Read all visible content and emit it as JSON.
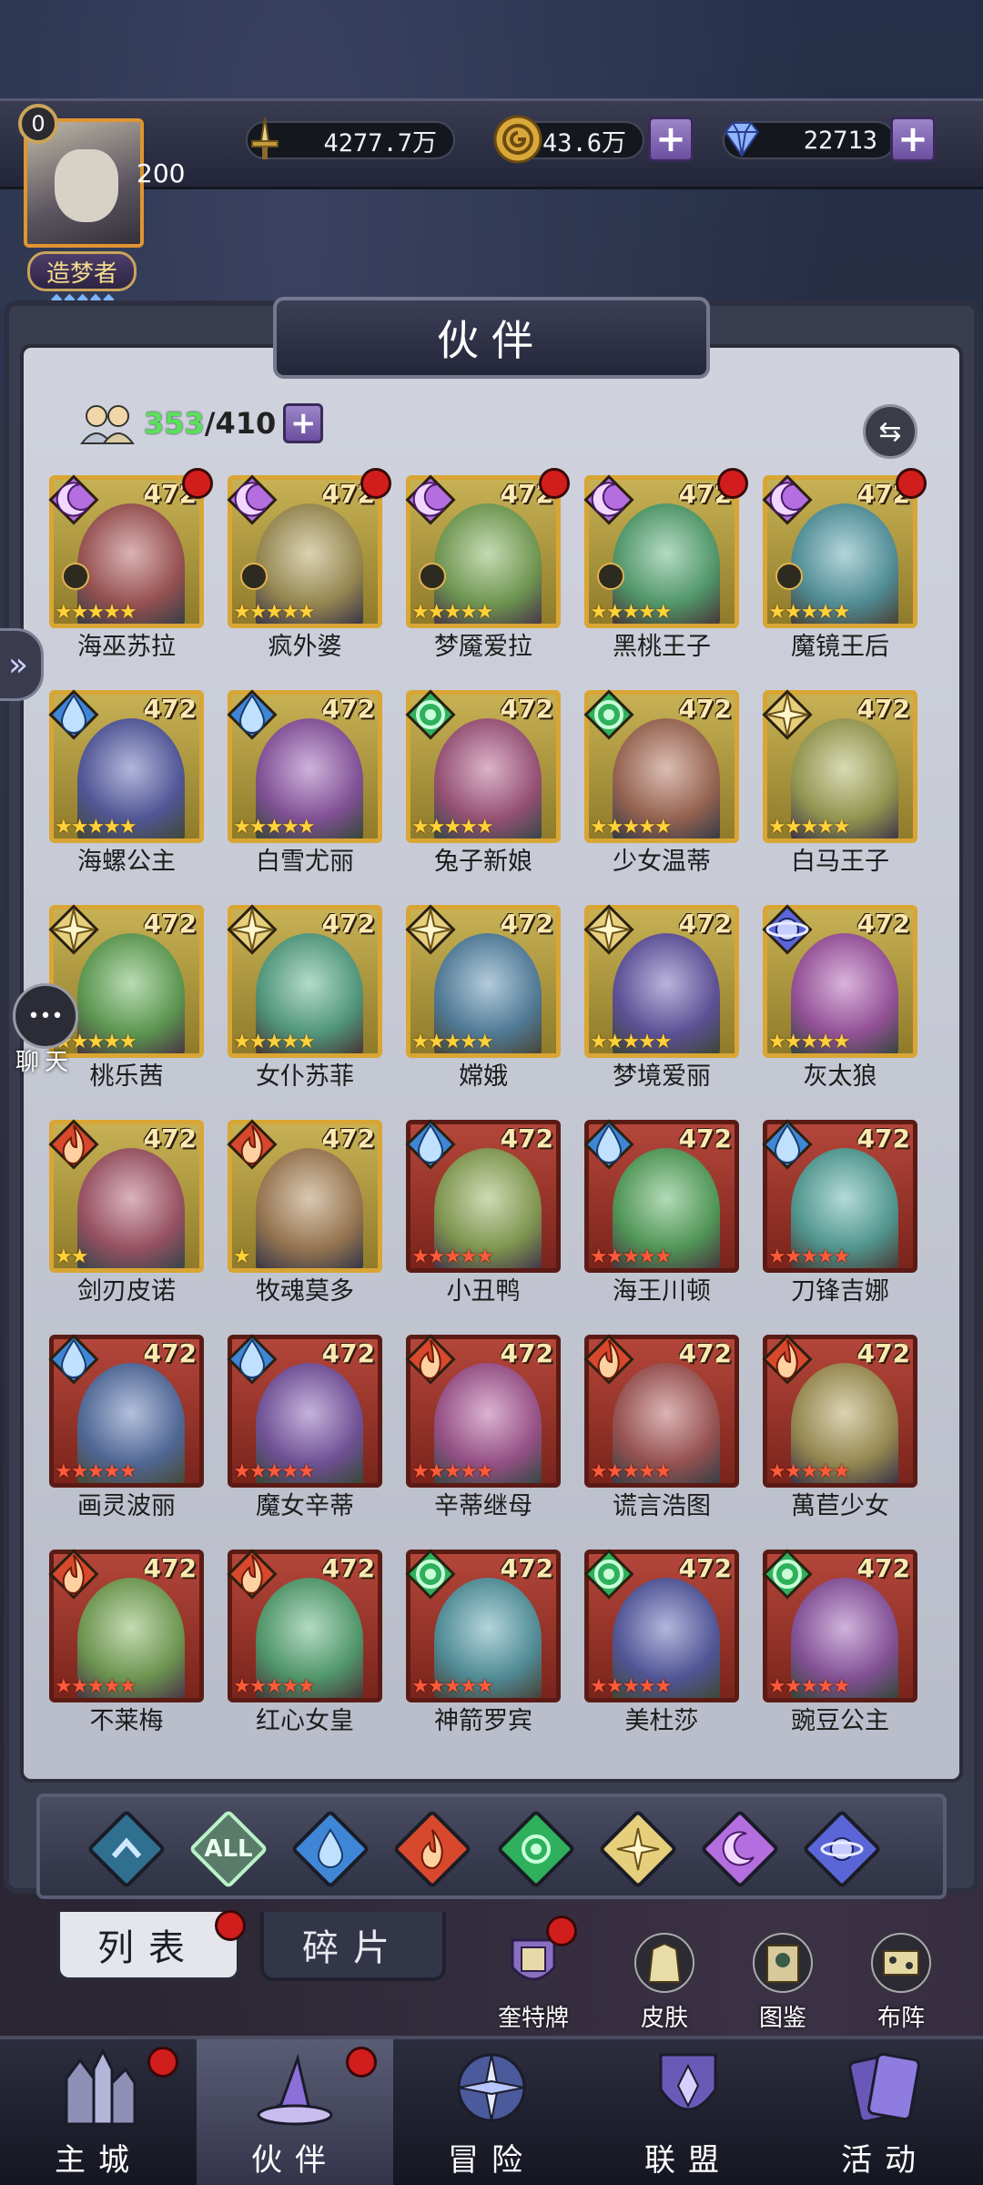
{
  "player": {
    "level": "0",
    "exp": "200",
    "title": "造梦者"
  },
  "resources": {
    "power": "4277.7万",
    "gold": "43.6万",
    "gems": "22713"
  },
  "panel": {
    "title": "伙伴",
    "count_current": "353",
    "count_sep": "/410"
  },
  "heroes": [
    {
      "name": "海巫苏拉",
      "level": "472",
      "element": "moon",
      "stars": 5,
      "frame": "gold",
      "dot": true
    },
    {
      "name": "疯外婆",
      "level": "472",
      "element": "moon",
      "stars": 5,
      "frame": "gold",
      "dot": true
    },
    {
      "name": "梦魇爱拉",
      "level": "472",
      "element": "moon",
      "stars": 5,
      "frame": "gold",
      "dot": true
    },
    {
      "name": "黑桃王子",
      "level": "472",
      "element": "moon",
      "stars": 5,
      "frame": "gold",
      "dot": true
    },
    {
      "name": "魔镜王后",
      "level": "472",
      "element": "moon",
      "stars": 5,
      "frame": "gold",
      "dot": true
    },
    {
      "name": "海螺公主",
      "level": "472",
      "element": "water",
      "stars": 5,
      "frame": "gold",
      "dot": false
    },
    {
      "name": "白雪尤丽",
      "level": "472",
      "element": "water",
      "stars": 5,
      "frame": "gold",
      "dot": false
    },
    {
      "name": "兔子新娘",
      "level": "472",
      "element": "wind",
      "stars": 5,
      "frame": "gold",
      "dot": false
    },
    {
      "name": "少女温蒂",
      "level": "472",
      "element": "wind",
      "stars": 5,
      "frame": "gold",
      "dot": false
    },
    {
      "name": "白马王子",
      "level": "472",
      "element": "light",
      "stars": 5,
      "frame": "gold",
      "dot": false
    },
    {
      "name": "桃乐茜",
      "level": "472",
      "element": "light",
      "stars": 5,
      "frame": "gold",
      "dot": false
    },
    {
      "name": "女仆苏菲",
      "level": "472",
      "element": "light",
      "stars": 5,
      "frame": "gold",
      "dot": false
    },
    {
      "name": "嫦娥",
      "level": "472",
      "element": "light",
      "stars": 5,
      "frame": "gold",
      "dot": false
    },
    {
      "name": "梦境爱丽",
      "level": "472",
      "element": "light",
      "stars": 5,
      "frame": "gold",
      "dot": false
    },
    {
      "name": "灰太狼",
      "level": "472",
      "element": "star",
      "stars": 5,
      "frame": "gold",
      "dot": false
    },
    {
      "name": "剑刃皮诺",
      "level": "472",
      "element": "fire",
      "stars": 2,
      "frame": "gold",
      "dot": false
    },
    {
      "name": "牧魂莫多",
      "level": "472",
      "element": "fire",
      "stars": 1,
      "frame": "gold",
      "dot": false
    },
    {
      "name": "小丑鸭",
      "level": "472",
      "element": "water",
      "stars": 5,
      "frame": "red",
      "dot": false
    },
    {
      "name": "海王川顿",
      "level": "472",
      "element": "water",
      "stars": 5,
      "frame": "red",
      "dot": false
    },
    {
      "name": "刀锋吉娜",
      "level": "472",
      "element": "water",
      "stars": 5,
      "frame": "red",
      "dot": false
    },
    {
      "name": "画灵波丽",
      "level": "472",
      "element": "water",
      "stars": 5,
      "frame": "red",
      "dot": false
    },
    {
      "name": "魔女辛蒂",
      "level": "472",
      "element": "water",
      "stars": 5,
      "frame": "red",
      "dot": false
    },
    {
      "name": "辛蒂继母",
      "level": "472",
      "element": "fire",
      "stars": 5,
      "frame": "red",
      "dot": false
    },
    {
      "name": "谎言浩图",
      "level": "472",
      "element": "fire",
      "stars": 5,
      "frame": "red",
      "dot": false
    },
    {
      "name": "萬苣少女",
      "level": "472",
      "element": "fire",
      "stars": 5,
      "frame": "red",
      "dot": false
    },
    {
      "name": "不莱梅",
      "level": "472",
      "element": "fire",
      "stars": 5,
      "frame": "red",
      "dot": false
    },
    {
      "name": "红心女皇",
      "level": "472",
      "element": "fire",
      "stars": 5,
      "frame": "red",
      "dot": false
    },
    {
      "name": "神箭罗宾",
      "level": "472",
      "element": "wind",
      "stars": 5,
      "frame": "red",
      "dot": false
    },
    {
      "name": "美杜莎",
      "level": "472",
      "element": "wind",
      "stars": 5,
      "frame": "red",
      "dot": false
    },
    {
      "name": "豌豆公主",
      "level": "472",
      "element": "wind",
      "stars": 5,
      "frame": "red",
      "dot": false
    }
  ],
  "filters": [
    {
      "id": "fav",
      "label": ""
    },
    {
      "id": "all",
      "label": "ALL"
    },
    {
      "id": "water",
      "label": ""
    },
    {
      "id": "fire",
      "label": ""
    },
    {
      "id": "wind",
      "label": ""
    },
    {
      "id": "light",
      "label": ""
    },
    {
      "id": "moon",
      "label": ""
    },
    {
      "id": "star",
      "label": ""
    }
  ],
  "colors": {
    "water": "#3f86d6",
    "fire": "#d8482c",
    "wind": "#2fb05c",
    "light": "#e6cf7c",
    "moon": "#b46ee0",
    "star": "#5a66d8",
    "fav": "#2f6f8f",
    "all": "#5a7a6a"
  },
  "subtabs": {
    "list": "列表",
    "fragments": "碎片"
  },
  "side_buttons": {
    "cards": "奎特牌",
    "skins": "皮肤",
    "codex": "图鉴",
    "formation": "布阵"
  },
  "nav": {
    "castle": "主城",
    "partners": "伙伴",
    "adventure": "冒险",
    "alliance": "联盟",
    "events": "活动"
  },
  "chat": {
    "label": "聊天"
  }
}
